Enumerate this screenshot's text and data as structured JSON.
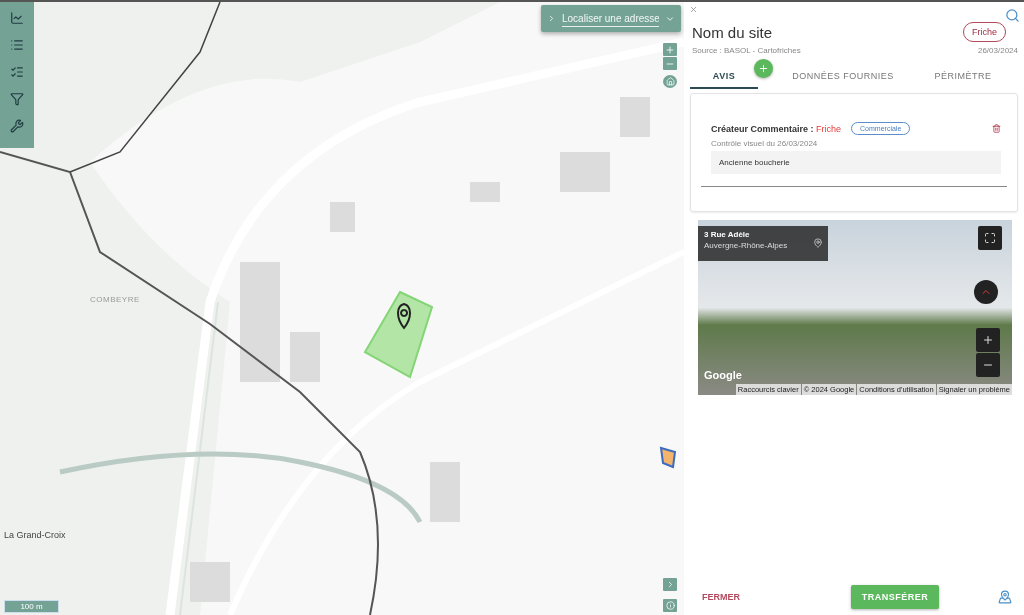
{
  "map": {
    "search": {
      "placeholder": "Localiser une adresse"
    },
    "place_labels": [
      {
        "text": "COMBEYRE",
        "kind": "district"
      },
      {
        "text": "La Grand-Croix",
        "kind": "town"
      }
    ],
    "scale": "100 m"
  },
  "panel": {
    "title": "Nom du site",
    "status": "Friche",
    "source": "Source : BASOL - Cartofriches",
    "date": "26/03/2024",
    "tabs": [
      {
        "label": "AVIS",
        "selected": true
      },
      {
        "label": "DONNÉES FOURNIES",
        "selected": false
      },
      {
        "label": "PÉRIMÈTRE",
        "selected": false
      }
    ],
    "comment": {
      "author": "Créateur Commentaire :",
      "status": "Friche",
      "tag": "Commerciale",
      "subtitle": "Contrôle visuel du 26/03/2024",
      "text": "Ancienne boucherie"
    },
    "street_view": {
      "address": "3 Rue Adèle",
      "region": "Auvergne-Rhône-Alpes",
      "logo": "Google",
      "links": [
        "Raccourcis clavier",
        "© 2024 Google",
        "Conditions d'utilisation",
        "Signaler un problème"
      ]
    },
    "buttons": {
      "close": "FERMER",
      "transfer": "TRANSFÉRER"
    }
  }
}
